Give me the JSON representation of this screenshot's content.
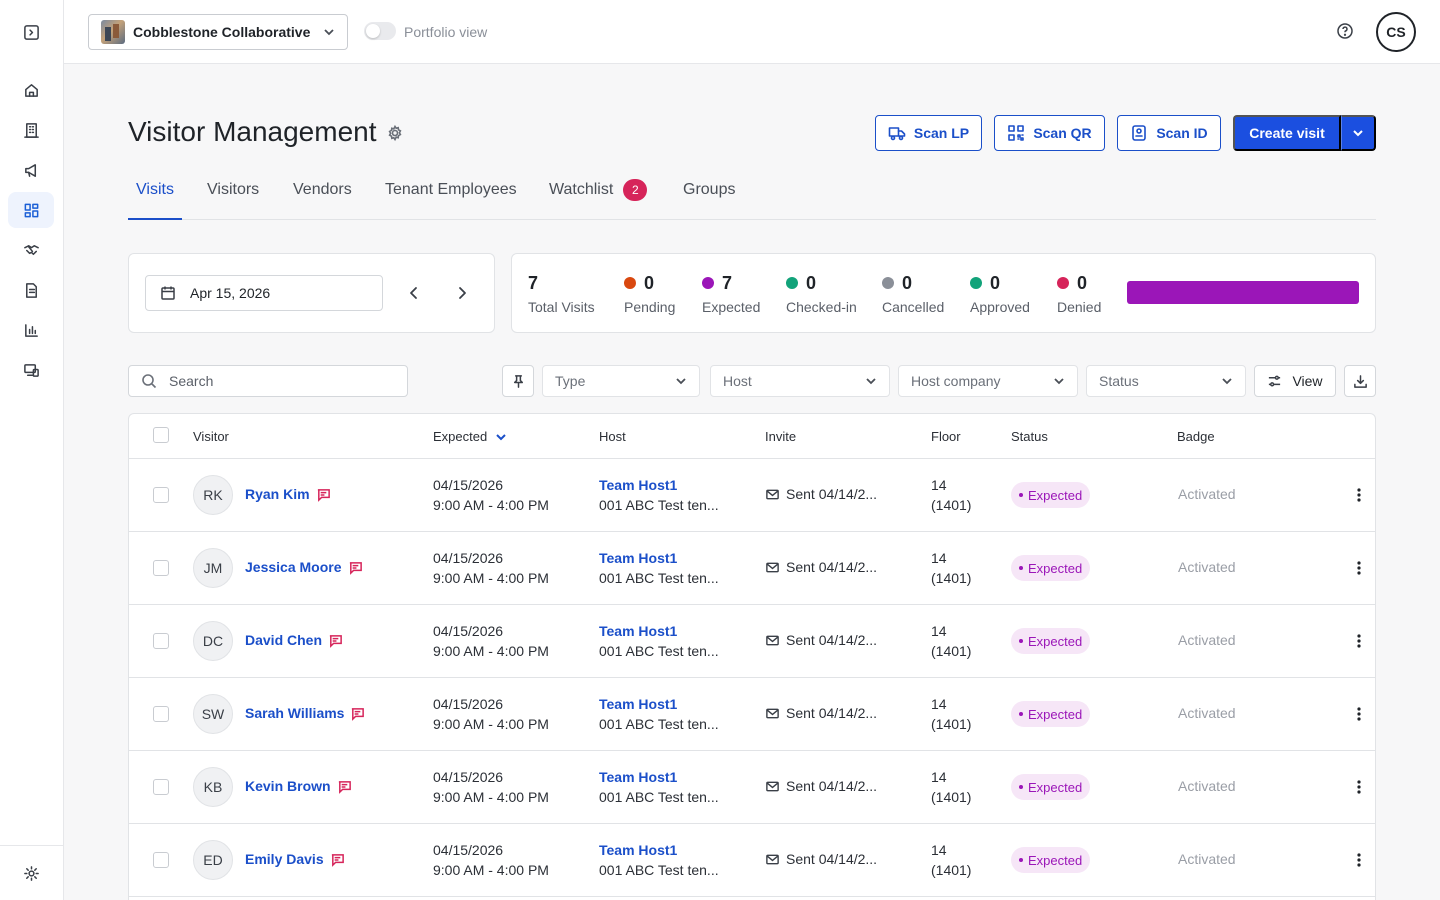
{
  "topbar": {
    "org_name": "Cobblestone Collaborative",
    "portfolio_label": "Portfolio view",
    "user_initials": "CS"
  },
  "header": {
    "title": "Visitor Management",
    "scan_lp": "Scan LP",
    "scan_qr": "Scan QR",
    "scan_id": "Scan ID",
    "create_visit": "Create visit"
  },
  "tabs": [
    {
      "label": "Visits",
      "active": true
    },
    {
      "label": "Visitors"
    },
    {
      "label": "Vendors"
    },
    {
      "label": "Tenant Employees"
    },
    {
      "label": "Watchlist",
      "badge": "2"
    },
    {
      "label": "Groups"
    }
  ],
  "date": {
    "value": "Apr 15, 2026"
  },
  "stats": [
    {
      "value": "7",
      "label": "Total Visits"
    },
    {
      "value": "0",
      "label": "Pending",
      "color": "#d9480f"
    },
    {
      "value": "7",
      "label": "Expected",
      "color": "#9b16b8"
    },
    {
      "value": "0",
      "label": "Checked-in",
      "color": "#12a37a"
    },
    {
      "value": "0",
      "label": "Cancelled",
      "color": "#8a8f98"
    },
    {
      "value": "0",
      "label": "Approved",
      "color": "#12a37a"
    },
    {
      "value": "0",
      "label": "Denied",
      "color": "#d6245a"
    }
  ],
  "status_bar": {
    "expected_fraction": 1.0,
    "color": "#9b16b8"
  },
  "filters": {
    "search_placeholder": "Search",
    "type": "Type",
    "host": "Host",
    "host_company": "Host company",
    "status": "Status",
    "view": "View"
  },
  "table": {
    "columns": [
      "Visitor",
      "Expected",
      "Host",
      "Invite",
      "Floor",
      "Status",
      "Badge"
    ],
    "rows": [
      {
        "initials": "RK",
        "name": "Ryan Kim",
        "date": "04/15/2026",
        "time": "9:00 AM - 4:00 PM",
        "host": "Team Host1",
        "host_company": "001 ABC Test ten...",
        "invite": "Sent 04/14/2...",
        "floor": "14",
        "suite": "(1401)",
        "status": "Expected",
        "badge": "Activated"
      },
      {
        "initials": "JM",
        "name": "Jessica Moore",
        "date": "04/15/2026",
        "time": "9:00 AM - 4:00 PM",
        "host": "Team Host1",
        "host_company": "001 ABC Test ten...",
        "invite": "Sent 04/14/2...",
        "floor": "14",
        "suite": "(1401)",
        "status": "Expected",
        "badge": "Activated"
      },
      {
        "initials": "DC",
        "name": "David Chen",
        "date": "04/15/2026",
        "time": "9:00 AM - 4:00 PM",
        "host": "Team Host1",
        "host_company": "001 ABC Test ten...",
        "invite": "Sent 04/14/2...",
        "floor": "14",
        "suite": "(1401)",
        "status": "Expected",
        "badge": "Activated"
      },
      {
        "initials": "SW",
        "name": "Sarah Williams",
        "date": "04/15/2026",
        "time": "9:00 AM - 4:00 PM",
        "host": "Team Host1",
        "host_company": "001 ABC Test ten...",
        "invite": "Sent 04/14/2...",
        "floor": "14",
        "suite": "(1401)",
        "status": "Expected",
        "badge": "Activated"
      },
      {
        "initials": "KB",
        "name": "Kevin Brown",
        "date": "04/15/2026",
        "time": "9:00 AM - 4:00 PM",
        "host": "Team Host1",
        "host_company": "001 ABC Test ten...",
        "invite": "Sent 04/14/2...",
        "floor": "14",
        "suite": "(1401)",
        "status": "Expected",
        "badge": "Activated"
      },
      {
        "initials": "ED",
        "name": "Emily Davis",
        "date": "04/15/2026",
        "time": "9:00 AM - 4:00 PM",
        "host": "Team Host1",
        "host_company": "001 ABC Test ten...",
        "invite": "Sent 04/14/2...",
        "floor": "14",
        "suite": "(1401)",
        "status": "Expected",
        "badge": "Activated"
      }
    ]
  }
}
